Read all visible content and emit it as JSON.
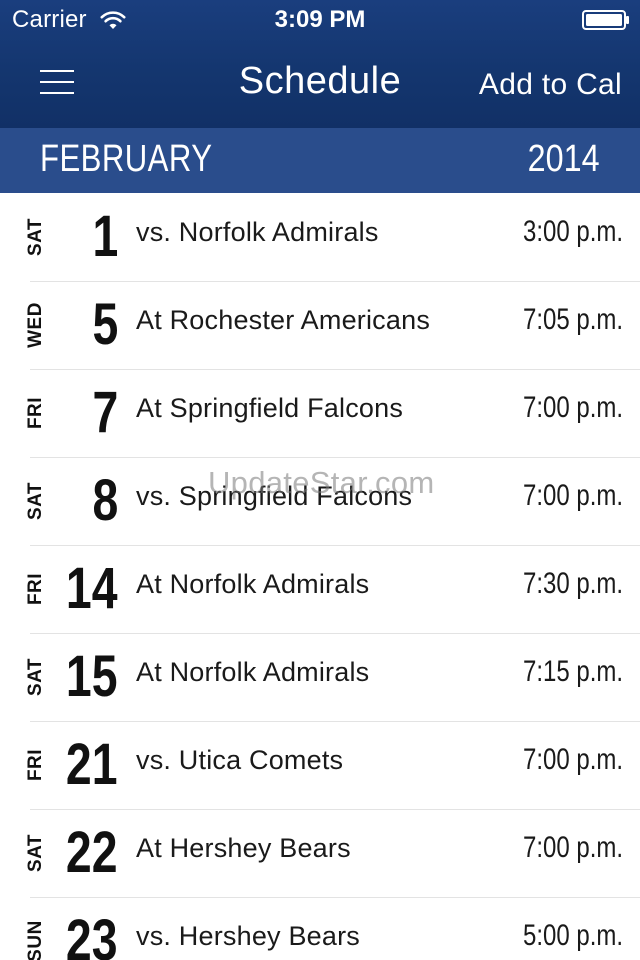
{
  "status_bar": {
    "carrier": "Carrier",
    "time": "3:09 PM"
  },
  "nav": {
    "title": "Schedule",
    "add_to_cal": "Add to Cal"
  },
  "month_header": {
    "month": "FEBRUARY",
    "year": "2014"
  },
  "games": [
    {
      "weekday": "SAT",
      "day": "1",
      "opponent": "vs. Norfolk Admirals",
      "time": "3:00 p.m."
    },
    {
      "weekday": "WED",
      "day": "5",
      "opponent": "At Rochester Americans",
      "time": "7:05 p.m."
    },
    {
      "weekday": "FRI",
      "day": "7",
      "opponent": "At Springfield Falcons",
      "time": "7:00 p.m."
    },
    {
      "weekday": "SAT",
      "day": "8",
      "opponent": "vs. Springfield Falcons",
      "time": "7:00 p.m."
    },
    {
      "weekday": "FRI",
      "day": "14",
      "opponent": "At Norfolk Admirals",
      "time": "7:30 p.m."
    },
    {
      "weekday": "SAT",
      "day": "15",
      "opponent": "At Norfolk Admirals",
      "time": "7:15 p.m."
    },
    {
      "weekday": "FRI",
      "day": "21",
      "opponent": "vs. Utica Comets",
      "time": "7:00 p.m."
    },
    {
      "weekday": "SAT",
      "day": "22",
      "opponent": "At Hershey Bears",
      "time": "7:00 p.m."
    },
    {
      "weekday": "SUN",
      "day": "23",
      "opponent": "vs. Hershey Bears",
      "time": "5:00 p.m."
    }
  ],
  "watermark": "UpdateStar.com",
  "colors": {
    "nav_background": "#14366f",
    "month_header_background": "#2a4d8c",
    "text_dark": "#111111",
    "separator": "#e3e3e3"
  }
}
